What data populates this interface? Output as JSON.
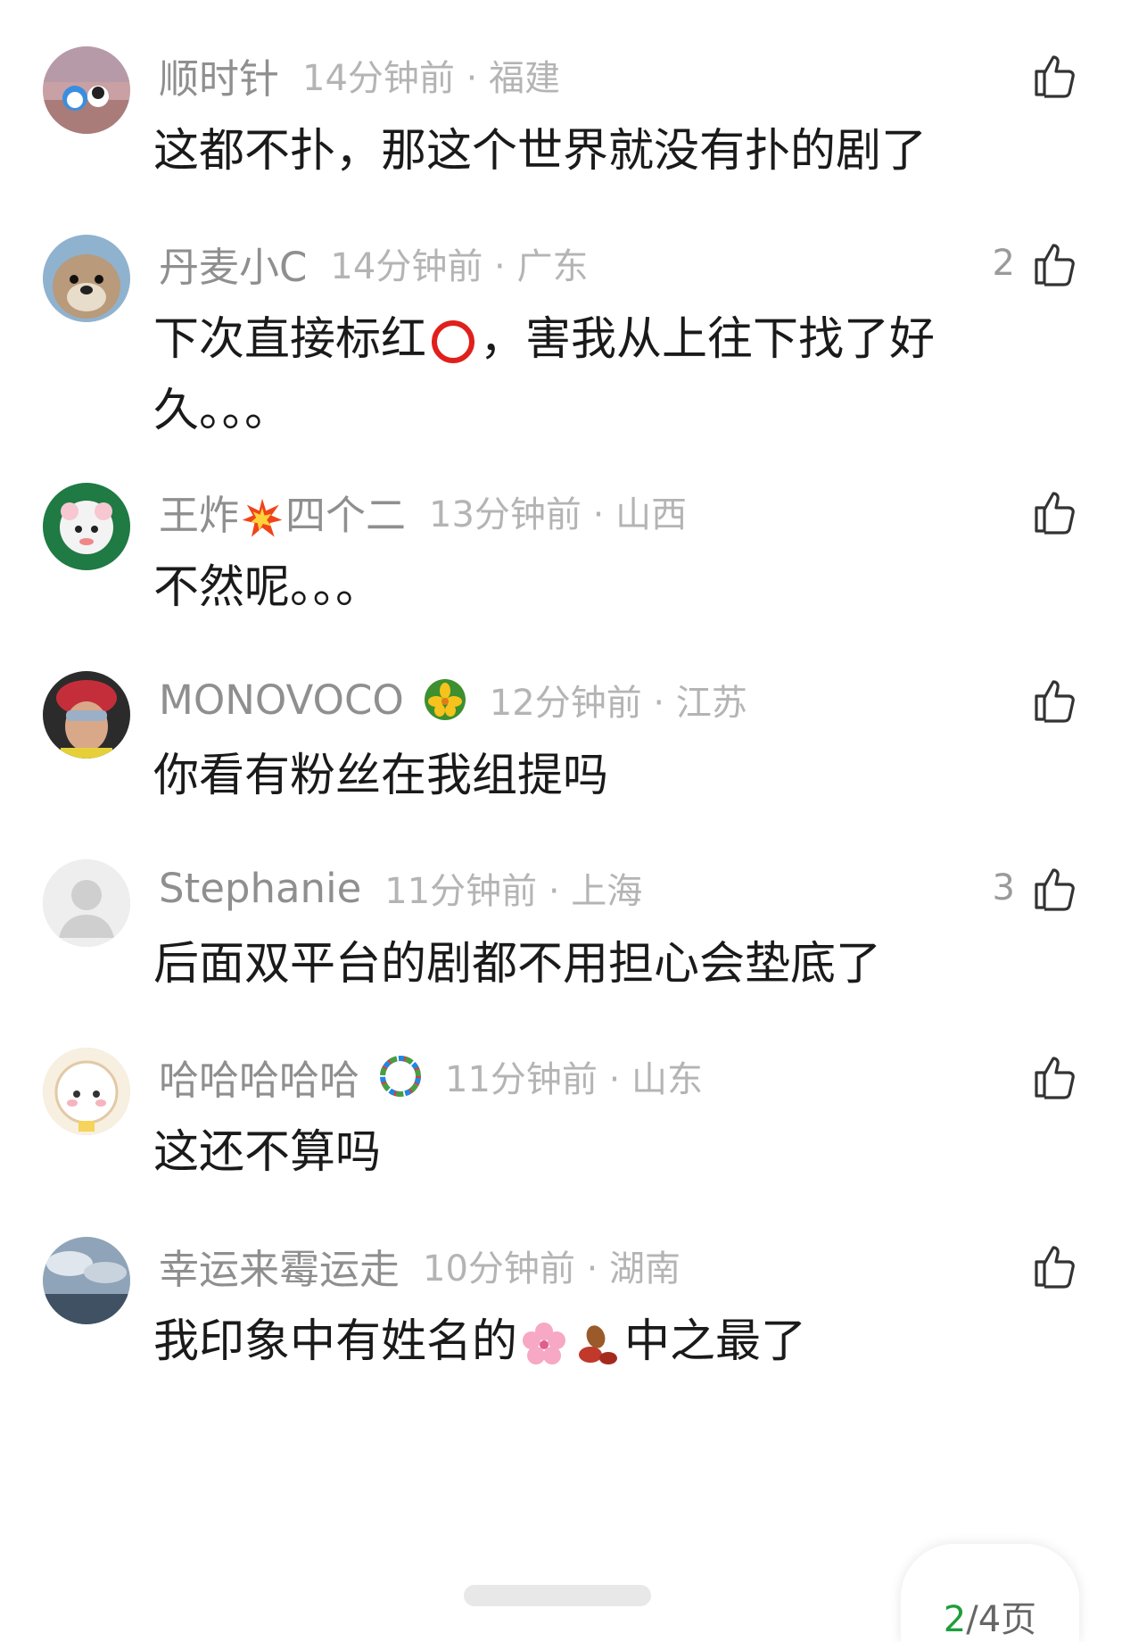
{
  "comments": [
    {
      "name": "顺时针",
      "time": "14分钟前 · 福建",
      "text": "这都不扑，那这个世界就没有扑的剧了",
      "likes": ""
    },
    {
      "name": "丹麦小C",
      "time": "14分钟前 · 广东",
      "text_before": "下次直接标红",
      "text_after": "，害我从上往下找了好久。。。",
      "emoji": "red-circle-icon",
      "likes": "2"
    },
    {
      "name_before": "王炸",
      "name_after": "四个二",
      "name_emoji": "explosion-icon",
      "time": "13分钟前 · 山西",
      "text": "不然呢。。。",
      "likes": ""
    },
    {
      "name": "MONOVOCO",
      "badge": "flower-badge-icon",
      "time": "12分钟前 · 江苏",
      "text": "你看有粉丝在我组提吗",
      "likes": ""
    },
    {
      "name": "Stephanie",
      "time": "11分钟前 · 上海",
      "text": "后面双平台的剧都不用担心会垫底了",
      "likes": "3"
    },
    {
      "name": "哈哈哈哈哈",
      "badge": "rainbow-badge-icon",
      "time": "11分钟前 · 山东",
      "text": "这还不算吗",
      "likes": ""
    },
    {
      "name": "幸运来霉运走",
      "time": "10分钟前 · 湖南",
      "text_before": "我印象中有姓名的",
      "text_after": "中之最了",
      "emojis": [
        "cherry-blossom-icon",
        "peanut-icon"
      ],
      "likes": ""
    }
  ],
  "pager": {
    "current": "2",
    "rest": "/4页"
  },
  "colors": {
    "name": "#8f8f8f",
    "time": "#b4b4b4",
    "text": "#1a1a1a",
    "pager_current": "#1e9e3e"
  }
}
